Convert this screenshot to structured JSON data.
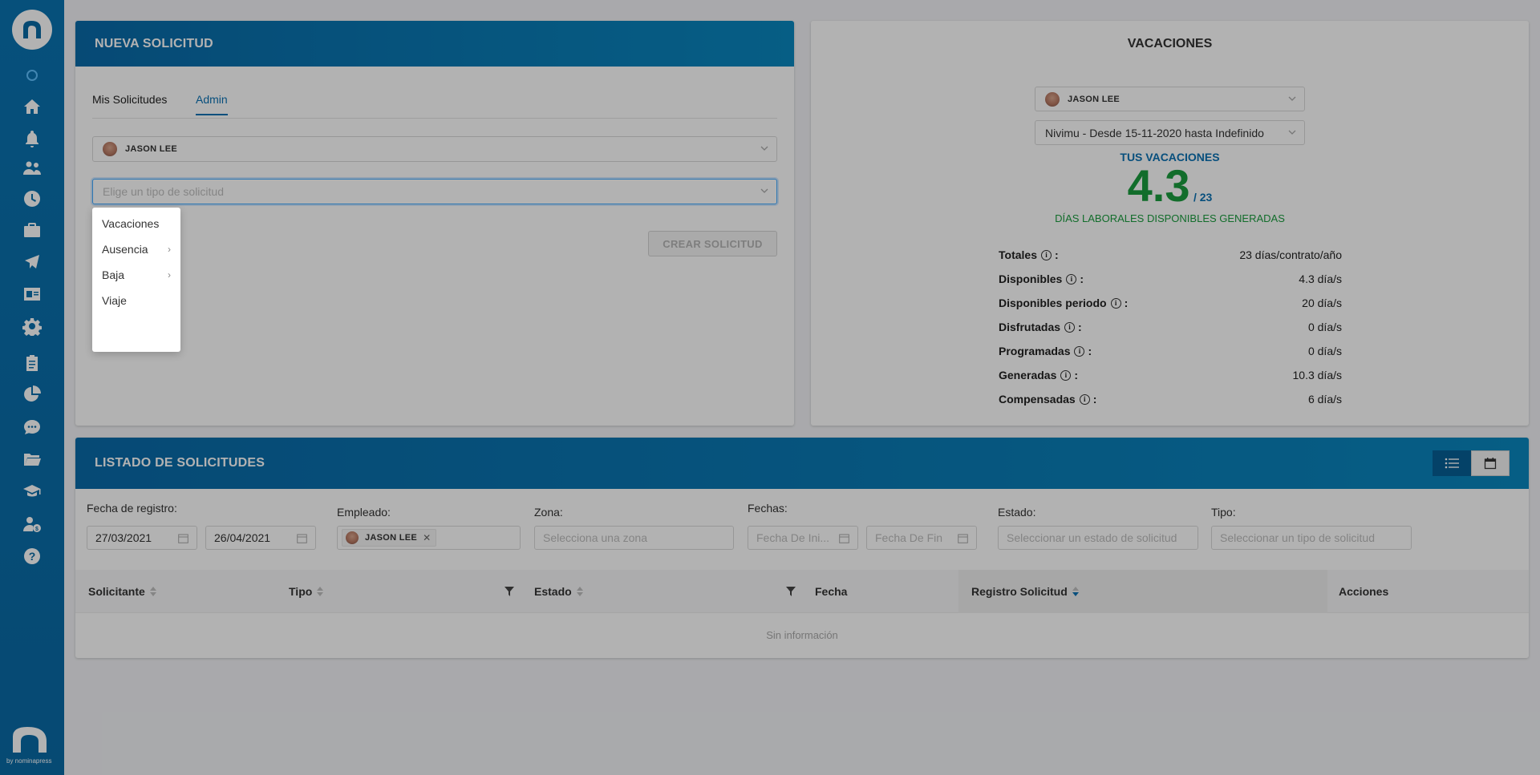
{
  "sidebar": {
    "items": [
      {
        "icon": "home-icon"
      },
      {
        "icon": "bell-icon"
      },
      {
        "icon": "users-icon"
      },
      {
        "icon": "clock-icon"
      },
      {
        "icon": "briefcase-icon"
      },
      {
        "icon": "plane-icon"
      },
      {
        "icon": "id-card-icon"
      },
      {
        "icon": "gear-icon"
      },
      {
        "icon": "clipboard-icon"
      },
      {
        "icon": "pie-chart-icon"
      },
      {
        "icon": "chat-icon"
      },
      {
        "icon": "folder-icon"
      },
      {
        "icon": "graduation-icon"
      },
      {
        "icon": "user-money-icon"
      },
      {
        "icon": "help-icon"
      }
    ],
    "byline": "by nominapress"
  },
  "nueva": {
    "title": "NUEVA SOLICITUD",
    "tabs": [
      "Mis Solicitudes",
      "Admin"
    ],
    "active_tab": "Admin",
    "employee": "JASON LEE",
    "type_placeholder": "Elige un tipo de solicitud",
    "create_label": "CREAR SOLICITUD",
    "dropdown": [
      "Vacaciones",
      "Ausencia",
      "Baja",
      "Viaje"
    ]
  },
  "vacaciones": {
    "title": "VACACIONES",
    "employee": "JASON LEE",
    "period": "Nivimu - Desde 15-11-2020 hasta Indefinido",
    "tus_label": "TUS VACACIONES",
    "available": "4.3",
    "total": "/ 23",
    "caption": "DÍAS LABORALES DISPONIBLES GENERADAS",
    "stats": [
      {
        "label": "Totales",
        "value": "23 días/contrato/año"
      },
      {
        "label": "Disponibles",
        "value": "4.3 día/s"
      },
      {
        "label": "Disponibles periodo",
        "value": "20 día/s"
      },
      {
        "label": "Disfrutadas",
        "value": "0 día/s"
      },
      {
        "label": "Programadas",
        "value": "0 día/s"
      },
      {
        "label": "Generadas",
        "value": "10.3 día/s"
      },
      {
        "label": "Compensadas",
        "value": "6 día/s"
      }
    ]
  },
  "listado": {
    "title": "LISTADO DE SOLICITUDES",
    "filters": {
      "fecha_registro_label": "Fecha de registro:",
      "fecha_desde": "27/03/2021",
      "fecha_hasta": "26/04/2021",
      "empleado_label": "Empleado:",
      "empleado_tag": "JASON LEE",
      "zona_label": "Zona:",
      "zona_placeholder": "Selecciona una zona",
      "fechas_label": "Fechas:",
      "fecha_inicio_placeholder": "Fecha De Ini...",
      "fecha_fin_placeholder": "Fecha De Fin",
      "estado_label": "Estado:",
      "estado_placeholder": "Seleccionar un estado de solicitud",
      "tipo_label": "Tipo:",
      "tipo_placeholder": "Seleccionar un tipo de solicitud"
    },
    "columns": [
      "Solicitante",
      "Tipo",
      "Estado",
      "Fecha",
      "Registro Solicitud",
      "Acciones"
    ],
    "empty_text": "Sin información"
  }
}
